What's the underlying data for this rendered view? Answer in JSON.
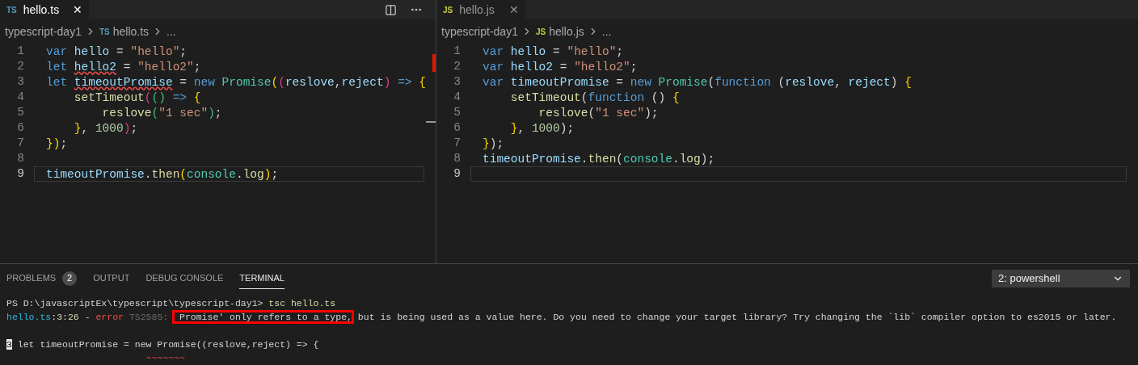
{
  "editors": [
    {
      "focused": true,
      "tab": {
        "badge": "TS",
        "label": "hello.ts",
        "close": "✕",
        "selected": true
      },
      "breadcrumb": {
        "folder": "typescript-day1",
        "badge": "TS",
        "file": "hello.ts",
        "more": "..."
      },
      "lines": [
        {
          "number": "1",
          "current": false,
          "tokens": [
            {
              "text": "var ",
              "kind": "kw"
            },
            {
              "text": "hello",
              "kind": "var"
            },
            {
              "text": " = ",
              "kind": "p"
            },
            {
              "text": "\"hello\"",
              "kind": "str"
            },
            {
              "text": ";",
              "kind": "p"
            }
          ]
        },
        {
          "number": "2",
          "current": false,
          "tokens": [
            {
              "text": "let ",
              "kind": "kw"
            },
            {
              "text": "hello2",
              "kind": "var",
              "error": true
            },
            {
              "text": " = ",
              "kind": "p"
            },
            {
              "text": "\"hello2\"",
              "kind": "str"
            },
            {
              "text": ";",
              "kind": "p"
            }
          ]
        },
        {
          "number": "3",
          "current": false,
          "tokens": [
            {
              "text": "let ",
              "kind": "kw"
            },
            {
              "text": "timeoutPromise",
              "kind": "var",
              "error": true
            },
            {
              "text": " = ",
              "kind": "p"
            },
            {
              "text": "new ",
              "kind": "kw"
            },
            {
              "text": "Promise",
              "kind": "cls"
            },
            {
              "text": "(",
              "kind": "b1"
            },
            {
              "text": "(",
              "kind": "b2"
            },
            {
              "text": "reslove",
              "kind": "var"
            },
            {
              "text": ",",
              "kind": "p"
            },
            {
              "text": "reject",
              "kind": "param"
            },
            {
              "text": ") ",
              "kind": "b2"
            },
            {
              "text": "=> ",
              "kind": "kw"
            },
            {
              "text": "{",
              "kind": "b1"
            }
          ]
        },
        {
          "number": "4",
          "current": false,
          "tokens": [
            {
              "text": "    setTimeout",
              "kind": "fn"
            },
            {
              "text": "(",
              "kind": "b2"
            },
            {
              "text": "() ",
              "kind": "b3"
            },
            {
              "text": "=> ",
              "kind": "kw"
            },
            {
              "text": "{",
              "kind": "b1"
            }
          ]
        },
        {
          "number": "5",
          "current": false,
          "tokens": [
            {
              "text": "        reslove",
              "kind": "fn"
            },
            {
              "text": "(",
              "kind": "b3"
            },
            {
              "text": "\"1 sec\"",
              "kind": "str"
            },
            {
              "text": ")",
              "kind": "b3"
            },
            {
              "text": ";",
              "kind": "p"
            }
          ]
        },
        {
          "number": "6",
          "current": false,
          "tokens": [
            {
              "text": "    }",
              "kind": "b1"
            },
            {
              "text": ", ",
              "kind": "p"
            },
            {
              "text": "1000",
              "kind": "num"
            },
            {
              "text": ")",
              "kind": "b2"
            },
            {
              "text": ";",
              "kind": "p"
            }
          ]
        },
        {
          "number": "7",
          "current": false,
          "tokens": [
            {
              "text": "})",
              "kind": "b1"
            },
            {
              "text": ";",
              "kind": "p"
            }
          ]
        },
        {
          "number": "8",
          "current": false
        },
        {
          "number": "9",
          "current": true,
          "tokens": [
            {
              "text": "timeoutPromise",
              "kind": "var"
            },
            {
              "text": ".",
              "kind": "p"
            },
            {
              "text": "then",
              "kind": "fn"
            },
            {
              "text": "(",
              "kind": "b1"
            },
            {
              "text": "console",
              "kind": "cls"
            },
            {
              "text": ".",
              "kind": "p"
            },
            {
              "text": "log",
              "kind": "fn"
            },
            {
              "text": ")",
              "kind": "b1"
            },
            {
              "text": ";",
              "kind": "p"
            }
          ]
        }
      ]
    },
    {
      "focused": false,
      "tab": {
        "badge": "JS",
        "label": "hello.js",
        "close": "✕",
        "selected": true
      },
      "breadcrumb": {
        "folder": "typescript-day1",
        "badge": "JS",
        "file": "hello.js",
        "more": "..."
      },
      "lines": [
        {
          "number": "1",
          "current": false,
          "tokens": [
            {
              "text": "var ",
              "kind": "kw"
            },
            {
              "text": "hello",
              "kind": "var"
            },
            {
              "text": " = ",
              "kind": "p"
            },
            {
              "text": "\"hello\"",
              "kind": "str"
            },
            {
              "text": ";",
              "kind": "p"
            }
          ]
        },
        {
          "number": "2",
          "current": false,
          "tokens": [
            {
              "text": "var ",
              "kind": "kw"
            },
            {
              "text": "hello2",
              "kind": "var"
            },
            {
              "text": " = ",
              "kind": "p"
            },
            {
              "text": "\"hello2\"",
              "kind": "str"
            },
            {
              "text": ";",
              "kind": "p"
            }
          ]
        },
        {
          "number": "3",
          "current": false,
          "tokens": [
            {
              "text": "var ",
              "kind": "kw"
            },
            {
              "text": "timeoutPromise",
              "kind": "var"
            },
            {
              "text": " = ",
              "kind": "p"
            },
            {
              "text": "new ",
              "kind": "kw"
            },
            {
              "text": "Promise",
              "kind": "cls"
            },
            {
              "text": "(",
              "kind": "p"
            },
            {
              "text": "function",
              "kind": "kw"
            },
            {
              "text": " (",
              "kind": "p"
            },
            {
              "text": "reslove",
              "kind": "var"
            },
            {
              "text": ", ",
              "kind": "p"
            },
            {
              "text": "reject",
              "kind": "param"
            },
            {
              "text": ") ",
              "kind": "p"
            },
            {
              "text": "{",
              "kind": "b1"
            }
          ]
        },
        {
          "number": "4",
          "current": false,
          "tokens": [
            {
              "text": "    setTimeout",
              "kind": "fn"
            },
            {
              "text": "(",
              "kind": "p"
            },
            {
              "text": "function",
              "kind": "kw"
            },
            {
              "text": " () ",
              "kind": "p"
            },
            {
              "text": "{",
              "kind": "b1"
            }
          ]
        },
        {
          "number": "5",
          "current": false,
          "tokens": [
            {
              "text": "        reslove",
              "kind": "fn"
            },
            {
              "text": "(",
              "kind": "p"
            },
            {
              "text": "\"1 sec\"",
              "kind": "str"
            },
            {
              "text": ");",
              "kind": "p"
            }
          ]
        },
        {
          "number": "6",
          "current": false,
          "tokens": [
            {
              "text": "    }",
              "kind": "b1"
            },
            {
              "text": ", ",
              "kind": "p"
            },
            {
              "text": "1000",
              "kind": "num"
            },
            {
              "text": ");",
              "kind": "p"
            }
          ]
        },
        {
          "number": "7",
          "current": false,
          "tokens": [
            {
              "text": "}",
              "kind": "b1"
            },
            {
              "text": ");",
              "kind": "p"
            }
          ]
        },
        {
          "number": "8",
          "current": false,
          "tokens": [
            {
              "text": "timeoutPromise",
              "kind": "var"
            },
            {
              "text": ".",
              "kind": "p"
            },
            {
              "text": "then",
              "kind": "fn"
            },
            {
              "text": "(",
              "kind": "p"
            },
            {
              "text": "console",
              "kind": "cls"
            },
            {
              "text": ".",
              "kind": "p"
            },
            {
              "text": "log",
              "kind": "fn"
            },
            {
              "text": ");",
              "kind": "p"
            }
          ]
        },
        {
          "number": "9",
          "current": true
        }
      ]
    }
  ],
  "panel": {
    "tabs": [
      {
        "label": "PROBLEMS",
        "badge": "2",
        "selected": false
      },
      {
        "label": "OUTPUT",
        "selected": false
      },
      {
        "label": "DEBUG CONSOLE",
        "selected": false
      },
      {
        "label": "TERMINAL",
        "selected": true
      }
    ],
    "terminal_select": "2: powershell",
    "terminal": [
      {
        "tokens": [
          {
            "text": "PS D:\\javascriptEx\\typescript\\typescript-day1> ",
            "kind": "p"
          },
          {
            "text": "tsc hello.ts",
            "kind": "fn"
          }
        ]
      },
      {
        "tokens": [
          {
            "text": "hello.ts",
            "kind": "cyan"
          },
          {
            "text": ":",
            "kind": "p"
          },
          {
            "text": "3",
            "kind": "fn"
          },
          {
            "text": ":",
            "kind": "p"
          },
          {
            "text": "26",
            "kind": "fn"
          },
          {
            "text": " - ",
            "kind": "p"
          },
          {
            "text": "error",
            "kind": "red"
          },
          {
            "text": " TS2585: ",
            "kind": "dim"
          },
          {
            "text": " Promise' only refers to a type,",
            "kind": "p",
            "highlighted": true
          },
          {
            "text": " but is being used as a value here. Do you need to change your target library? Try changing the `lib` compiler option to es2015 or later.",
            "kind": "p"
          }
        ],
        "blank_line_after": true
      },
      {
        "tokens": [
          {
            "text": "3",
            "kind": "gutter"
          },
          {
            "text": " let timeoutPromise = new Promise((reslove,reject) => {",
            "kind": "p"
          }
        ]
      },
      {
        "tokens": [
          {
            "text": "                         ~~~~~~~",
            "kind": "red"
          }
        ]
      }
    ]
  }
}
